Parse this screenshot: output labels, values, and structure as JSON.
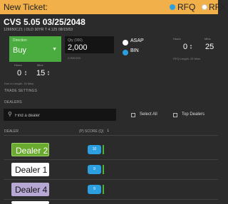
{
  "window": {
    "title": "New Ticket:",
    "modes": [
      {
        "label": "RFQ",
        "selected": true
      },
      {
        "label": "RFX",
        "selected": false
      }
    ]
  },
  "security": {
    "title": "CVS 5.05 03/25/2048",
    "subtitle": "126650CZ1 | OLD 30YR T 4.125 08/15/53"
  },
  "direction": {
    "label": "Direction",
    "value": "Buy"
  },
  "quantity": {
    "label": "Qty (000)",
    "value": "2,000",
    "hint": "2,000,000"
  },
  "timing": {
    "options": [
      {
        "label": "ASAP",
        "selected": false
      },
      {
        "label": "BIN",
        "selected": true
      }
    ]
  },
  "rfq_length": {
    "hours_label": "Hours",
    "hours": "0",
    "mins_label": "Mins",
    "mins": "25",
    "hint": "RFQ Length: 25 Mins"
  },
  "due_in": {
    "hours_label": "Hours",
    "hours": "0",
    "mins_label": "Mins",
    "mins": "15",
    "hint": "Due in Length: 15 Mins"
  },
  "trade_settings_label": "TRADE SETTINGS",
  "dealers": {
    "section_label": "DEALERS",
    "search_placeholder": "Find a dealer",
    "select_all_label": "Select All",
    "top_dealers_label": "Top Dealers",
    "col_dealer": "DEALER",
    "col_score": "(P) SCORE (Q)",
    "rows": [
      {
        "name": "Dealer 2",
        "score": "10",
        "color": "#6aaa2e",
        "text": "#ffffff"
      },
      {
        "name": "Dealer 1",
        "score": "9",
        "color": "#ffffff",
        "text": "#111111"
      },
      {
        "name": "Dealer 4",
        "score": "9",
        "color": "#b7a7d4",
        "text": "#111111"
      }
    ]
  },
  "colors": {
    "accent": "#2b9fe0",
    "buy": "#4aab3e",
    "titlebar": "#f1b04a"
  }
}
